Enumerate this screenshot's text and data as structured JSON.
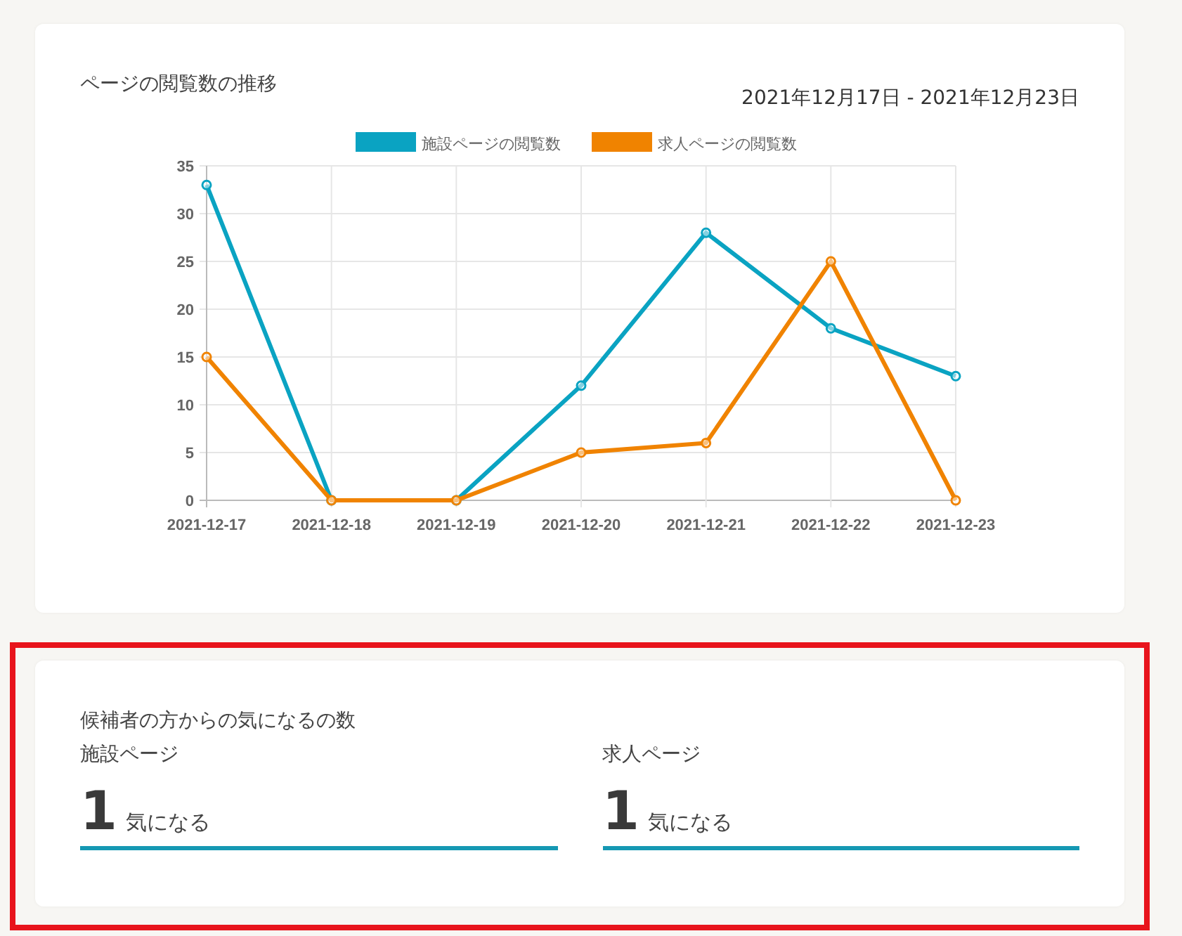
{
  "views_card": {
    "title": "ページの閲覧数の推移",
    "date_range": "2021年12月17日 - 2021年12月23日",
    "chart_data": {
      "type": "line",
      "categories": [
        "2021-12-17",
        "2021-12-18",
        "2021-12-19",
        "2021-12-20",
        "2021-12-21",
        "2021-12-22",
        "2021-12-23"
      ],
      "series": [
        {
          "name": "施設ページの閲覧数",
          "color": "#0aa3c2",
          "marker": "circle",
          "values": [
            33,
            0,
            0,
            12,
            28,
            18,
            13
          ]
        },
        {
          "name": "求人ページの閲覧数",
          "color": "#f08300",
          "marker": "circle",
          "values": [
            15,
            0,
            0,
            5,
            6,
            25,
            0
          ]
        }
      ],
      "grid": true,
      "legend": "top",
      "ylim": [
        0,
        35
      ],
      "yticks": [
        0,
        5,
        10,
        15,
        20,
        25,
        30,
        35
      ]
    }
  },
  "favorites_card": {
    "highlighted": true,
    "title": "候補者の方からの気になるの数",
    "stats": [
      {
        "label": "施設ページ",
        "value": "1",
        "unit": "気になる"
      },
      {
        "label": "求人ページ",
        "value": "1",
        "unit": "気になる"
      }
    ]
  }
}
